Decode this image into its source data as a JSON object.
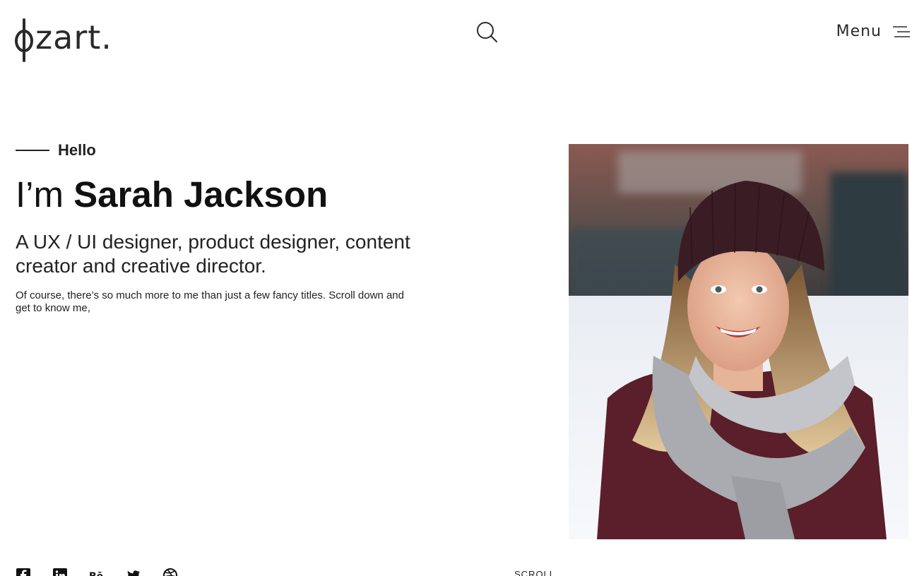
{
  "header": {
    "logo_text": "zart.",
    "menu_label": "Menu",
    "icons": {
      "logo": "phi-logo-icon",
      "search": "search-icon",
      "menu": "hamburger-icon"
    }
  },
  "hero": {
    "greeting": "Hello",
    "headline_prefix": "I’m",
    "name": "Sarah Jackson",
    "subtitle": "A UX / UI designer, product designer, content creator and creative director.",
    "intro": "Of course, there’s so much more to me than just a few fancy titles. Scroll down and get to know me,"
  },
  "footer": {
    "social_icons": [
      "facebook-icon",
      "linkedin-icon",
      "behance-icon",
      "twitter-icon",
      "dribbble-icon"
    ],
    "scroll_label": "SCROLL"
  },
  "colors": {
    "text": "#111111",
    "background": "#ffffff",
    "accent": "#2a2a2a"
  }
}
